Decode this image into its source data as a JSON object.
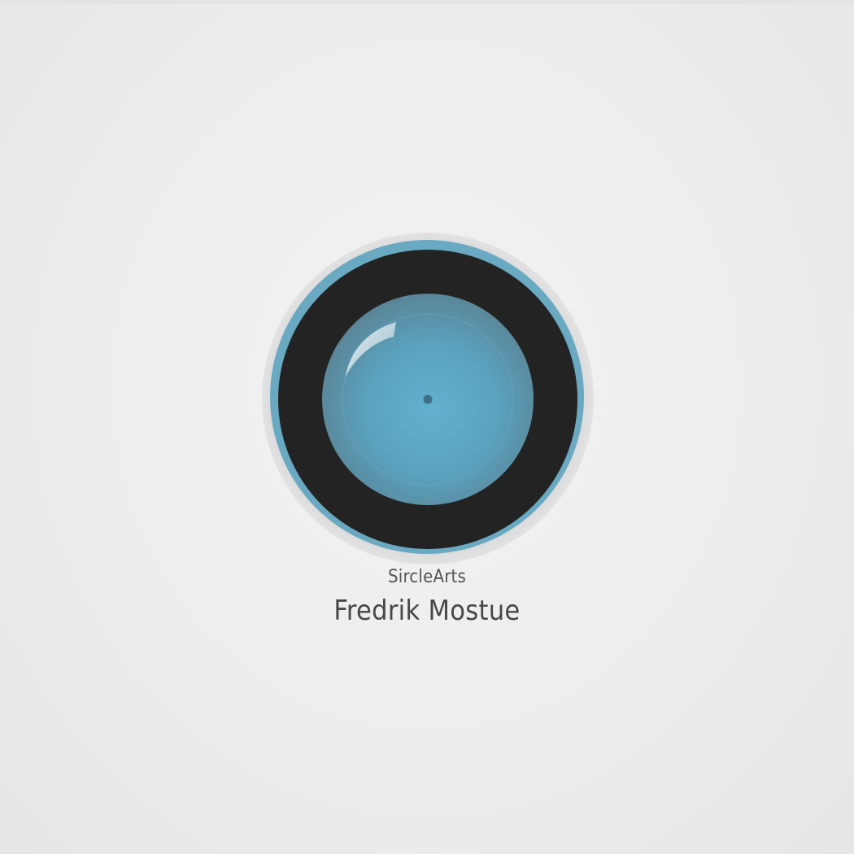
{
  "logo": {
    "icon": "camera-lens-icon",
    "colors": {
      "background": "#eeeeee",
      "halo": "#dcdcdc",
      "accent": "#6aa9c2",
      "ring": "#232323",
      "lens": "#5aa6c4",
      "pupil": "#3f6f82"
    }
  },
  "brand": {
    "small": "SircleArts",
    "name": "Fredrik Mostue"
  }
}
